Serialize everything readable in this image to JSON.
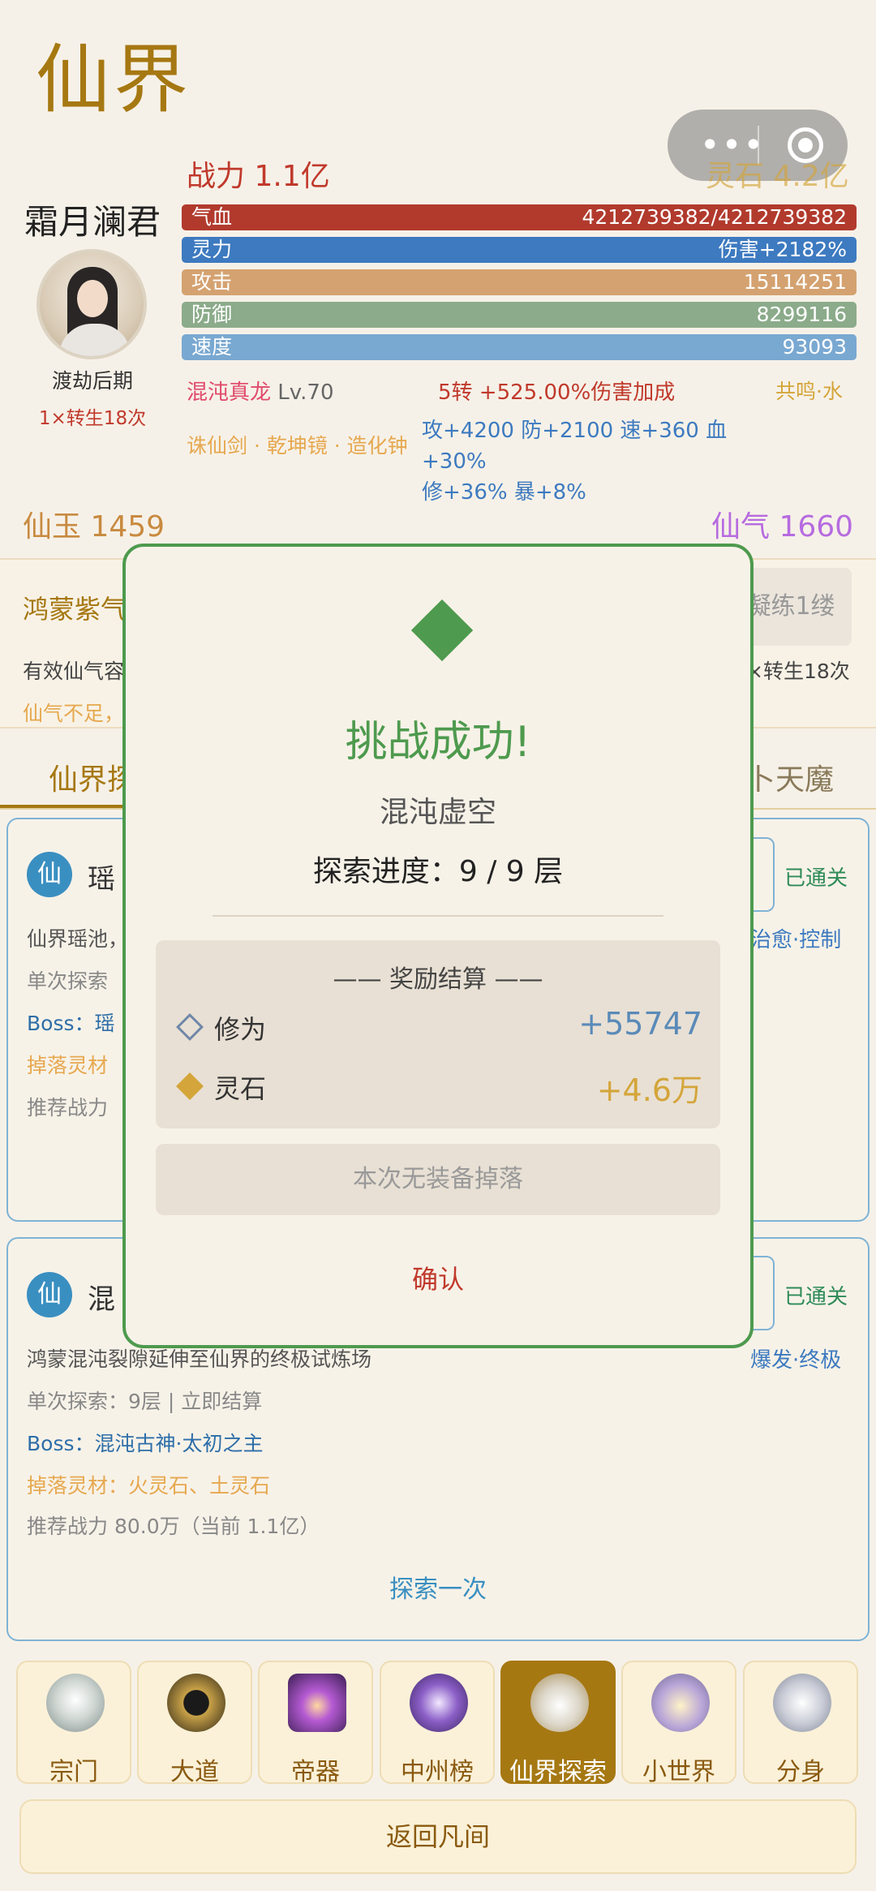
{
  "page": {
    "title": "仙界"
  },
  "profile": {
    "name": "霜月澜君",
    "realm": "渡劫后期",
    "rebirth": "1×转生18次",
    "power": "战力 1.1亿",
    "spirit_stone": "灵石 4.2亿"
  },
  "bars": {
    "hp": {
      "label": "气血",
      "value": "4212739382/4212739382"
    },
    "sp": {
      "label": "灵力",
      "value": "伤害+2182%"
    },
    "atk": {
      "label": "攻击",
      "value": "15114251"
    },
    "def": {
      "label": "防御",
      "value": "8299116"
    },
    "spd": {
      "label": "速度",
      "value": "93093"
    }
  },
  "dragon": {
    "name": "混沌真龙",
    "level": "Lv.70",
    "bonus": "5转 +525.00%伤害加成",
    "resonance": "共鸣·水"
  },
  "artifacts": {
    "names": "诛仙剑 · 乾坤镜 · 造化钟",
    "stats_line1": "攻+4200 防+2100 速+360 血+30%",
    "stats_line2": "修+36% 暴+8%"
  },
  "currency": {
    "jade": "仙玉 1459",
    "qi": "仙气 1660"
  },
  "background": {
    "hongmeng": "鸿蒙紫气",
    "refine_btn": "凝练1缕",
    "effective": "有效仙气容",
    "rebirth": "×转生18次",
    "qi_low": "仙气不足，",
    "tab_left": "仙界探",
    "tab_right": "卜天魔",
    "card1": {
      "badge": "仙",
      "title": "瑶",
      "status": "已通关",
      "tags": "治愈·控制",
      "desc": "仙界瑶池，",
      "single": "单次探索",
      "boss": "Boss：瑶",
      "drop": "掉落灵材",
      "recommend": "推荐战力"
    },
    "card2": {
      "badge": "仙",
      "title": "混",
      "status": "已通关",
      "tags": "爆发·终极",
      "desc": "鸿蒙混沌裂隙延伸至仙界的终极试炼场",
      "single": "单次探索：9层 | 立即结算",
      "boss": "Boss：混沌古神·太初之主",
      "drop": "掉落灵材：火灵石、土灵石",
      "recommend": "推荐战力 80.0万（当前 1.1亿）",
      "explore": "探索一次"
    }
  },
  "nav": [
    {
      "label": "宗门",
      "icon": "sect-icon"
    },
    {
      "label": "大道",
      "icon": "dao-icon"
    },
    {
      "label": "帝器",
      "icon": "emperor-artifact-icon"
    },
    {
      "label": "中州榜",
      "icon": "ranking-icon"
    },
    {
      "label": "仙界探索",
      "icon": "immortal-explore-icon"
    },
    {
      "label": "小世界",
      "icon": "small-world-icon"
    },
    {
      "label": "分身",
      "icon": "clone-icon"
    }
  ],
  "back_label": "返回凡间",
  "modal": {
    "title": "挑战成功!",
    "location": "混沌虚空",
    "progress": "探索进度：9 / 9 层",
    "reward_header": "—— 奖励结算 ——",
    "rewards": [
      {
        "label": "修为",
        "value": "+55747"
      },
      {
        "label": "灵石",
        "value": "+4.6万"
      }
    ],
    "no_equipment": "本次无装备掉落",
    "confirm": "确认"
  },
  "colors": {
    "accent_gold": "#a67812",
    "success_green": "#4e9a4e",
    "danger_red": "#c0392b",
    "link_blue": "#3a8fc1"
  }
}
